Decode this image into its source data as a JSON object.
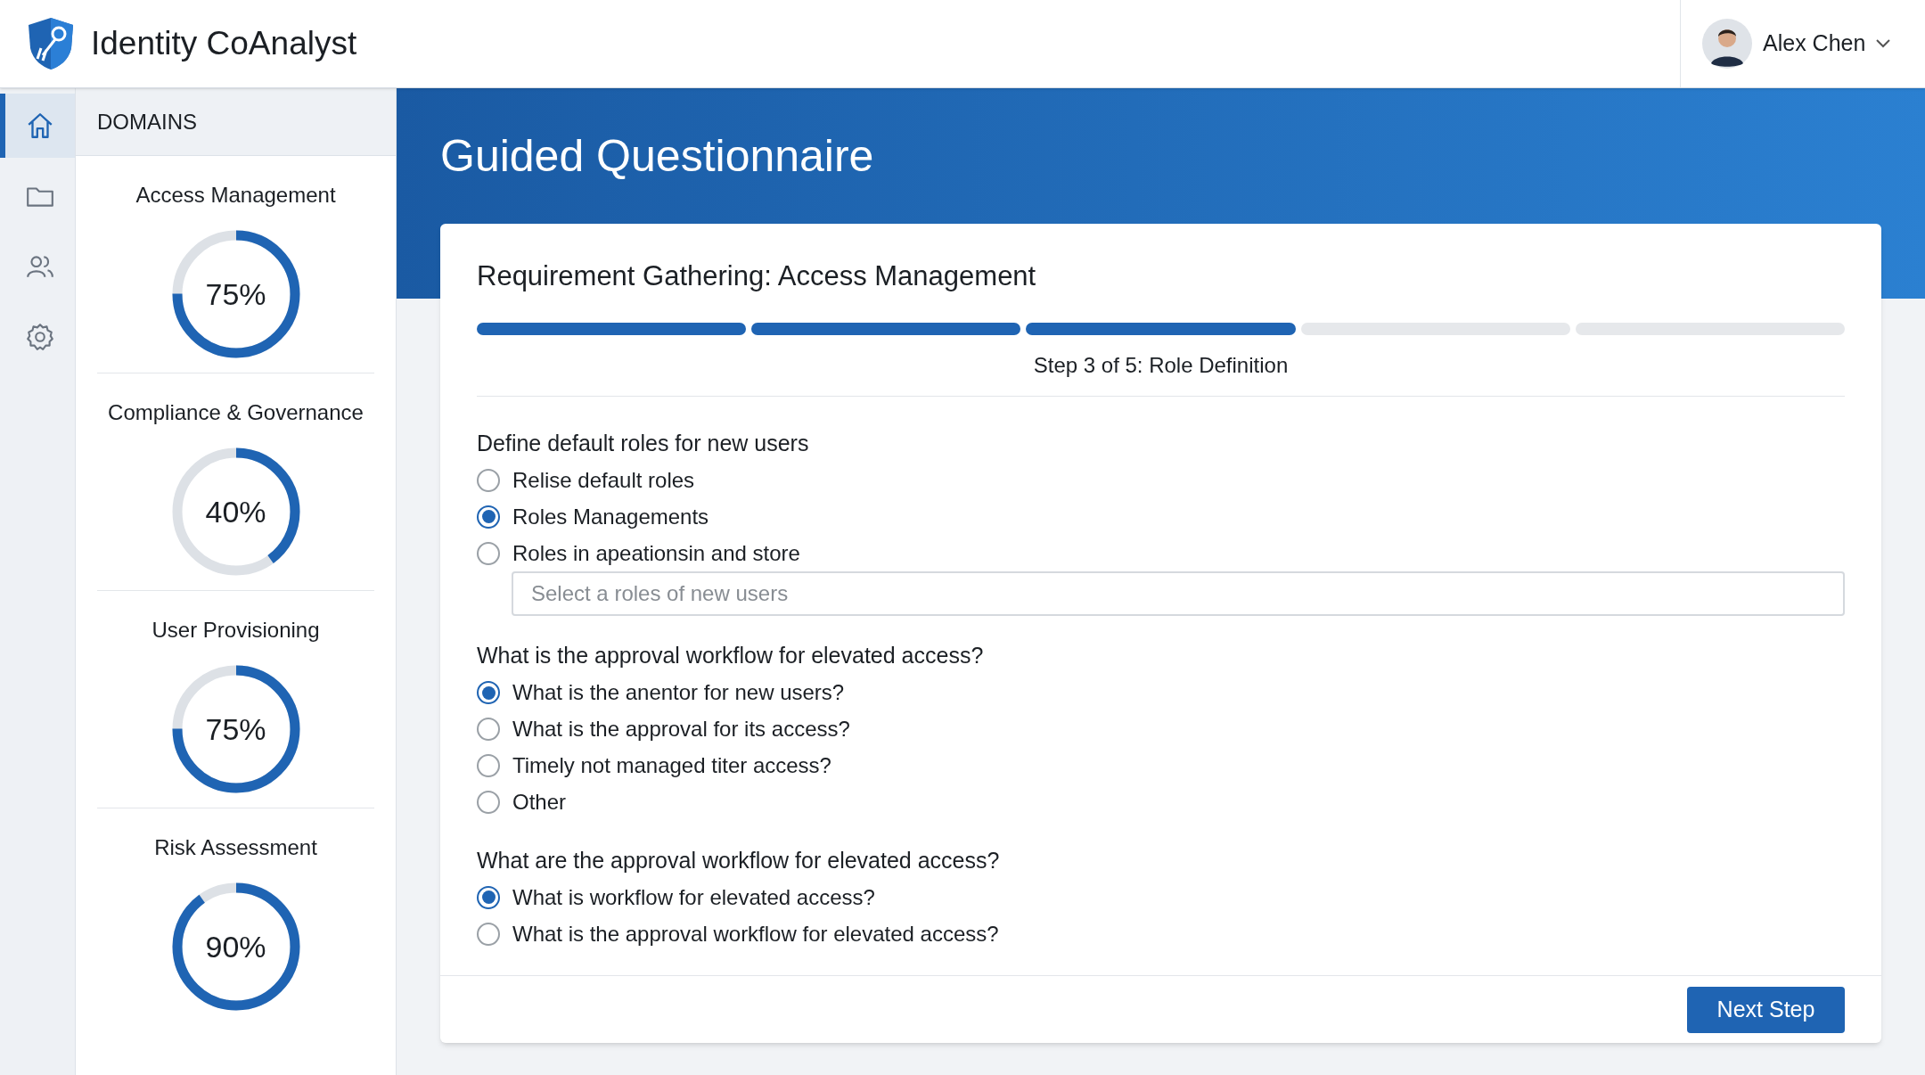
{
  "app": {
    "title": "Identity CoAnalyst"
  },
  "user": {
    "name": "Alex Chen"
  },
  "nav": [
    {
      "kind": "home",
      "selected": true
    },
    {
      "kind": "folder",
      "selected": false
    },
    {
      "kind": "users",
      "selected": false
    },
    {
      "kind": "settings",
      "selected": false
    }
  ],
  "domains": {
    "heading": "DOMAINS",
    "items": [
      {
        "name": "Access Management",
        "level": 0.75,
        "reading": "75%"
      },
      {
        "name": "Compliance & Governance",
        "level": 0.4,
        "reading": "40%"
      },
      {
        "name": "User Provisioning",
        "level": 0.75,
        "reading": "75%"
      },
      {
        "name": "Risk Assessment",
        "level": 0.9,
        "reading": "90%"
      }
    ]
  },
  "page": {
    "title": "Guided Questionnaire"
  },
  "card": {
    "title": "Requirement Gathering: Access Management",
    "steps": [
      {
        "done": true
      },
      {
        "done": true
      },
      {
        "done": true
      },
      {
        "done": false
      },
      {
        "done": false
      }
    ],
    "step_label": "Step 3 of 5: Role Definition",
    "questions": [
      {
        "label": "Define default roles for new users",
        "options": [
          {
            "label": "Relise default roles",
            "selected": false
          },
          {
            "label": "Roles Managements",
            "selected": true
          },
          {
            "label": "Roles in apeationsin and store",
            "selected": false
          }
        ],
        "placeholder": "Select a roles of new users"
      },
      {
        "label": "What is the approval workflow for elevated access?",
        "options": [
          {
            "label": "What is the anentor for new users?",
            "selected": true
          },
          {
            "label": "What is the approval for its access?",
            "selected": false
          },
          {
            "label": "Timely not managed titer access?",
            "selected": false
          },
          {
            "label": "Other",
            "selected": false
          }
        ]
      },
      {
        "label": "What are the approval workflow for elevated access?",
        "options": [
          {
            "label": "What is workflow for elevated access?",
            "selected": true
          },
          {
            "label": "What is the approval workflow for elevated access?",
            "selected": false
          }
        ]
      }
    ],
    "next_button": "Next Step"
  }
}
